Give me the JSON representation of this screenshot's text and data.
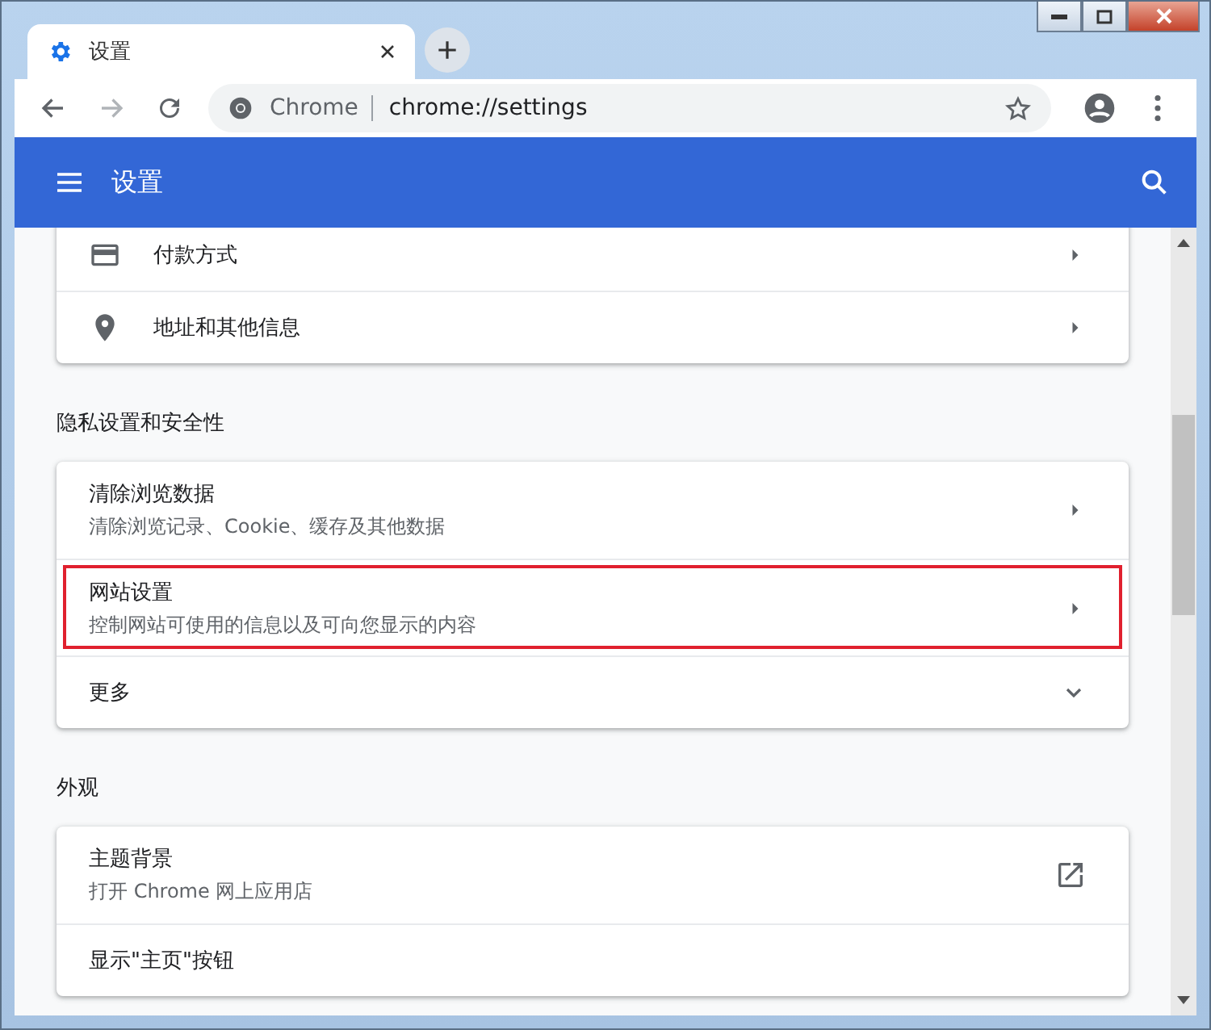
{
  "tab": {
    "title": "设置",
    "selected": true
  },
  "address_bar": {
    "site_label": "Chrome",
    "url": "chrome://settings"
  },
  "header": {
    "title": "设置"
  },
  "sections": [
    {
      "rows": [
        {
          "kind": "card",
          "title": "付款方式",
          "highlighted": false
        },
        {
          "kind": "pin",
          "title": "地址和其他信息",
          "highlighted": false
        }
      ]
    },
    {
      "title": "隐私设置和安全性",
      "rows": [
        {
          "kind": "link",
          "title": "清除浏览数据",
          "subtitle": "清除浏览记录、Cookie、缓存及其他数据",
          "highlighted": false
        },
        {
          "kind": "link",
          "title": "网站设置",
          "subtitle": "控制网站可使用的信息以及可向您显示的内容",
          "highlighted": true
        },
        {
          "kind": "expand",
          "title": "更多",
          "highlighted": false
        }
      ]
    },
    {
      "title": "外观",
      "rows": [
        {
          "kind": "external",
          "title": "主题背景",
          "subtitle": "打开 Chrome 网上应用店",
          "highlighted": false
        },
        {
          "kind": "plain",
          "title": "显示\"主页\"按钮",
          "highlighted": false
        }
      ]
    }
  ]
}
